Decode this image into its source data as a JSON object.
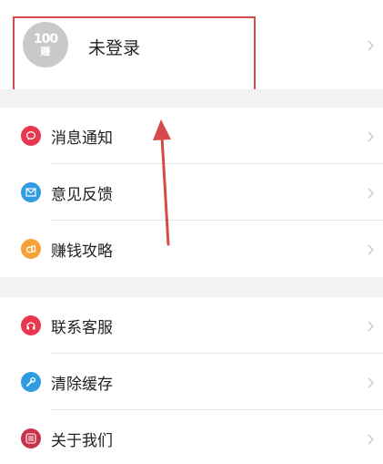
{
  "profile": {
    "avatar_line1": "100",
    "avatar_line2": "赚",
    "name": "未登录"
  },
  "menu_groups": [
    {
      "items": [
        {
          "label": "消息通知",
          "icon": "message-bubble-icon",
          "color": "#e8384f"
        },
        {
          "label": "意见反馈",
          "icon": "mail-icon",
          "color": "#2f9be0"
        },
        {
          "label": "赚钱攻略",
          "icon": "coins-icon",
          "color": "#f5a23a"
        }
      ]
    },
    {
      "items": [
        {
          "label": "联系客服",
          "icon": "headset-icon",
          "color": "#e8384f"
        },
        {
          "label": "清除缓存",
          "icon": "wrench-icon",
          "color": "#2f9be0"
        },
        {
          "label": "关于我们",
          "icon": "app-logo-icon",
          "color": "#c8324b"
        }
      ]
    }
  ],
  "colors": {
    "highlight": "#d84a4a",
    "section_gap": "#f2f2f2",
    "chevron": "#c6c6c6"
  }
}
